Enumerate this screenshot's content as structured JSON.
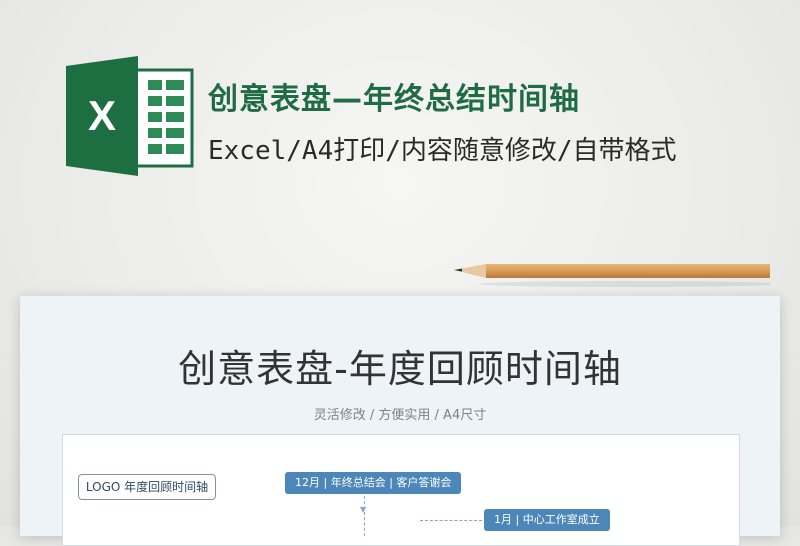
{
  "header": {
    "title": "创意表盘—年终总结时间轴",
    "subtitle": "Excel/A4打印/内容随意修改/自带格式",
    "logo_icon": "excel-icon",
    "logo_letter": "X"
  },
  "sheet": {
    "title": "创意表盘-年度回顾时间轴",
    "subtitle": "灵活修改 / 方便实用 / A4尺寸",
    "logo_box": "LOGO 年度回顾时间轴",
    "timeline": [
      {
        "label": "12月 | 年终总结会 | 客户答谢会"
      },
      {
        "label": "1月 | 中心工作室成立"
      }
    ]
  },
  "colors": {
    "brand_green": "#1f6b43",
    "excel_dark": "#1d6f42",
    "timeline_blue": "#4d86b8"
  }
}
